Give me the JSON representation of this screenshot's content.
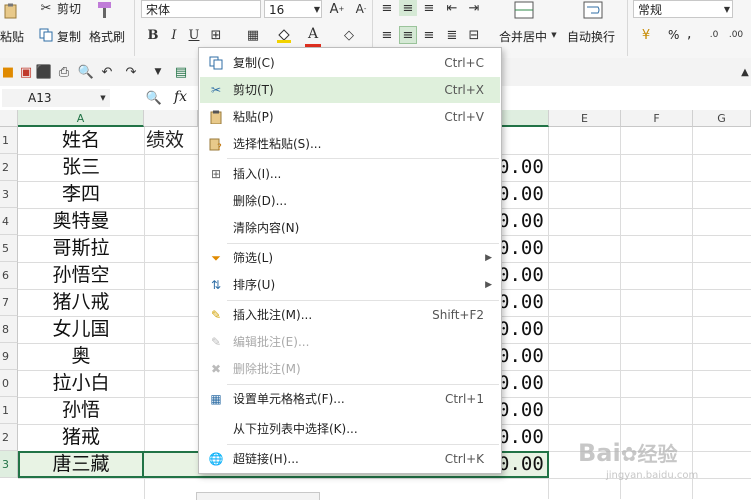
{
  "toolbar": {
    "cut_label": "剪切",
    "paste_label": "粘贴",
    "copy_label": "复制",
    "format_painter_label": "格式刷",
    "font_name": "宋体",
    "font_size": "16",
    "merge_center_label": "合并居中",
    "wrap_text_label": "自动换行",
    "number_format": "常规",
    "percent": "%",
    "thousands": ","
  },
  "formula_bar": {
    "name_box": "A13",
    "fx": "fx"
  },
  "columns": [
    "A",
    "E",
    "F",
    "G"
  ],
  "rows": [
    "1",
    "2",
    "3",
    "4",
    "5",
    "6",
    "7",
    "8",
    "9",
    "0",
    "1",
    "2",
    "3"
  ],
  "cells_a": [
    "姓名",
    "张三",
    "李四",
    "奥特曼",
    "哥斯拉",
    "孙悟空",
    "猪八戒",
    "女儿国",
    "奥",
    "拉小白",
    "孙悟",
    "猪戒",
    "唐三藏"
  ],
  "cell_b1": "绩效",
  "cells_d": [
    "0.00",
    "0.00",
    "0.00",
    "0.00",
    "0.00",
    "0.00",
    "0.00",
    "0.00",
    "0.00",
    "0.00",
    "0.00",
    "0.00"
  ],
  "context_menu": {
    "items": [
      {
        "label": "复制(C)",
        "shortcut": "Ctrl+C"
      },
      {
        "label": "剪切(T)",
        "shortcut": "Ctrl+X"
      },
      {
        "label": "粘贴(P)",
        "shortcut": "Ctrl+V"
      },
      {
        "label": "选择性粘贴(S)...",
        "shortcut": ""
      },
      {
        "label": "插入(I)...",
        "shortcut": ""
      },
      {
        "label": "删除(D)...",
        "shortcut": ""
      },
      {
        "label": "清除内容(N)",
        "shortcut": ""
      },
      {
        "label": "筛选(L)",
        "shortcut": ""
      },
      {
        "label": "排序(U)",
        "shortcut": ""
      },
      {
        "label": "插入批注(M)...",
        "shortcut": "Shift+F2"
      },
      {
        "label": "编辑批注(E)...",
        "shortcut": ""
      },
      {
        "label": "删除批注(M)",
        "shortcut": ""
      },
      {
        "label": "设置单元格格式(F)...",
        "shortcut": "Ctrl+1"
      },
      {
        "label": "从下拉列表中选择(K)...",
        "shortcut": ""
      },
      {
        "label": "超链接(H)...",
        "shortcut": "Ctrl+K"
      }
    ]
  },
  "watermark": {
    "brand": "Bai",
    "brand_cn": "经验",
    "url": "jingyan.baidu.com"
  },
  "colors": {
    "accent_green": "#217346",
    "menu_highlight": "#dff0dc"
  }
}
